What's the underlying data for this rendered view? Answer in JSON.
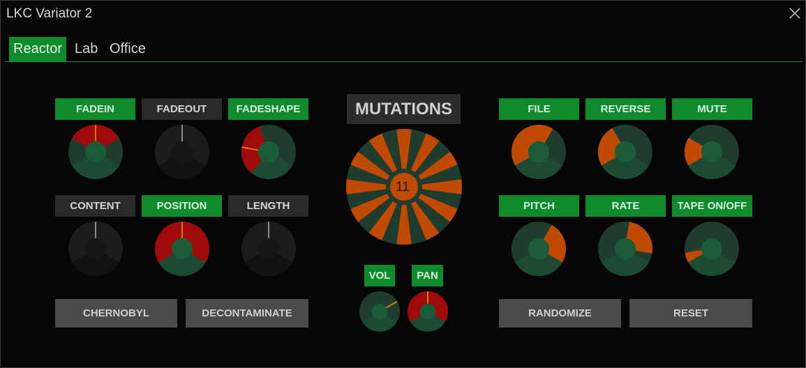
{
  "window": {
    "title": "LKC Variator 2",
    "close_icon": "close-icon"
  },
  "tabs": [
    {
      "label": "Reactor",
      "active": true
    },
    {
      "label": "Lab",
      "active": false
    },
    {
      "label": "Office",
      "active": false
    }
  ],
  "colors": {
    "accent_green": "#0f8a2c",
    "knob_track": "#1f3d2e",
    "knob_center": "#1a5c38",
    "fill_red": "#a00a0a",
    "fill_orange": "#c04a00",
    "inactive": "#1c1c1c"
  },
  "left_knobs": [
    {
      "label": "FADEIN",
      "active": true,
      "fill": "red",
      "arc_start": -60,
      "arc_end": 60,
      "pointer": 0
    },
    {
      "label": "FADEOUT",
      "active": false,
      "fill": "none",
      "arc_start": 0,
      "arc_end": 0,
      "pointer": 0
    },
    {
      "label": "FADESHAPE",
      "active": true,
      "fill": "red",
      "arc_start": -140,
      "arc_end": -20,
      "pointer": -80
    },
    {
      "label": "CONTENT",
      "active": false,
      "fill": "none",
      "arc_start": 0,
      "arc_end": 0,
      "pointer": 0
    },
    {
      "label": "POSITION",
      "active": true,
      "fill": "red",
      "arc_start": -120,
      "arc_end": 120,
      "pointer": 0
    },
    {
      "label": "LENGTH",
      "active": false,
      "fill": "none",
      "arc_start": 0,
      "arc_end": 0,
      "pointer": 0
    }
  ],
  "mutations": {
    "title": "MUTATIONS",
    "value": "11",
    "segments": 24
  },
  "mix": [
    {
      "label": "VOL",
      "fill": "none",
      "arc_start": 0,
      "arc_end": 0,
      "pointer": 60
    },
    {
      "label": "PAN",
      "fill": "red",
      "arc_start": -120,
      "arc_end": 120,
      "pointer": 0
    }
  ],
  "right_knobs": [
    {
      "label": "FILE",
      "active": true,
      "fill": "orange",
      "arc_start": -120,
      "arc_end": 30,
      "pointer": 30
    },
    {
      "label": "REVERSE",
      "active": true,
      "fill": "orange",
      "arc_start": -120,
      "arc_end": -30,
      "pointer": -30
    },
    {
      "label": "MUTE",
      "active": true,
      "fill": "orange",
      "arc_start": -120,
      "arc_end": -60,
      "pointer": -60
    },
    {
      "label": "PITCH",
      "active": true,
      "fill": "orange",
      "arc_start": 30,
      "arc_end": 120,
      "pointer": 30
    },
    {
      "label": "RATE",
      "active": true,
      "fill": "orange",
      "arc_start": 10,
      "arc_end": 100,
      "pointer": 10
    },
    {
      "label": "TAPE ON/OFF",
      "active": true,
      "fill": "orange",
      "arc_start": -120,
      "arc_end": -100,
      "pointer": -100
    }
  ],
  "buttons": {
    "chernobyl": "CHERNOBYL",
    "decontaminate": "DECONTAMINATE",
    "randomize": "RANDOMIZE",
    "reset": "RESET"
  }
}
